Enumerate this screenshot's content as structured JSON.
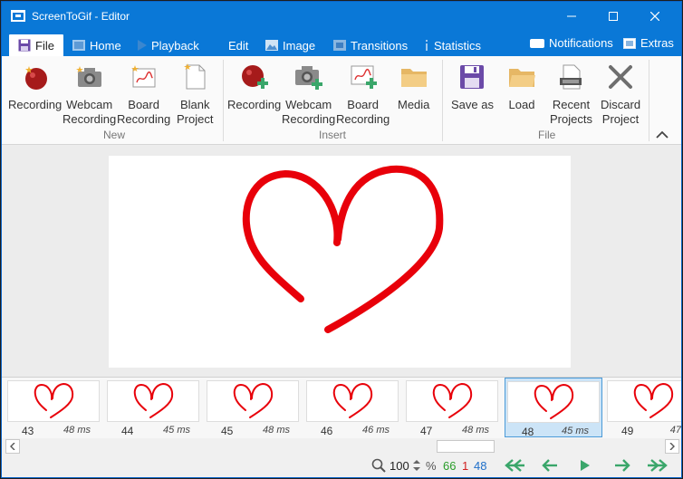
{
  "window": {
    "title": "ScreenToGif - Editor"
  },
  "tabs": [
    {
      "label": "File",
      "icon": "save-icon",
      "active": true
    },
    {
      "label": "Home",
      "icon": "home-icon"
    },
    {
      "label": "Playback",
      "icon": "play-icon"
    },
    {
      "label": "Edit"
    },
    {
      "label": "Image",
      "icon": "image-icon"
    },
    {
      "label": "Transitions",
      "icon": "transitions-icon"
    },
    {
      "label": "Statistics",
      "icon": "info-icon"
    }
  ],
  "tab_right": {
    "notifications": "Notifications",
    "extras": "Extras"
  },
  "ribbon": {
    "groups": {
      "new": "New",
      "insert": "Insert",
      "file": "File"
    },
    "new": {
      "recording": "Recording",
      "webcam_1": "Webcam",
      "webcam_2": "Recording",
      "board_1": "Board",
      "board_2": "Recording",
      "blank_1": "Blank",
      "blank_2": "Project"
    },
    "insert": {
      "recording": "Recording",
      "webcam_1": "Webcam",
      "webcam_2": "Recording",
      "board_1": "Board",
      "board_2": "Recording",
      "media": "Media"
    },
    "file": {
      "save_as": "Save as",
      "load": "Load",
      "recent_1": "Recent",
      "recent_2": "Projects",
      "discard_1": "Discard",
      "discard_2": "Project"
    }
  },
  "frames": [
    {
      "number": "43",
      "delay": "48 ms"
    },
    {
      "number": "44",
      "delay": "45 ms"
    },
    {
      "number": "45",
      "delay": "48 ms"
    },
    {
      "number": "46",
      "delay": "46 ms"
    },
    {
      "number": "47",
      "delay": "48 ms"
    },
    {
      "number": "48",
      "delay": "45 ms",
      "selected": true
    },
    {
      "number": "49",
      "delay": "47"
    }
  ],
  "status": {
    "zoom": "100",
    "percent": "%",
    "frame_count": "66",
    "selected_count": "1",
    "current_frame": "48"
  },
  "colors": {
    "accent": "#0a78d7",
    "heart": "#e8000a",
    "count_green": "#2a9d2a",
    "count_red": "#d12020",
    "count_blue": "#1f6fc9",
    "nav_green": "#3aa66a"
  }
}
